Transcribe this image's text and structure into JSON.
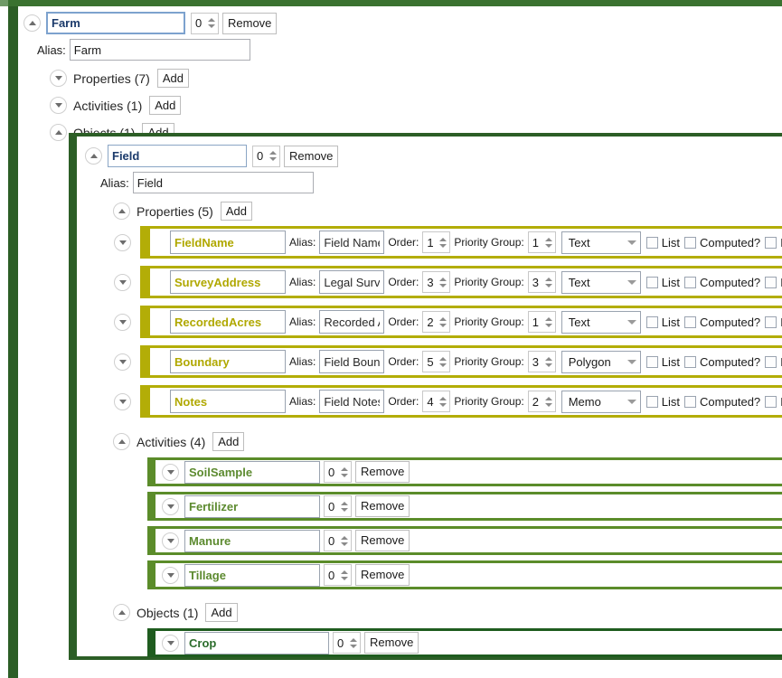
{
  "colors": {
    "panel_border_dark_green": "#2c5e26",
    "top_band_green": "#3a7230",
    "property_border_olive": "#b3ad07",
    "activity_border_green": "#5b8c2a",
    "object_border_green": "#1f5c1f",
    "property_name_text": "#b0a800",
    "activity_name_text": "#5c8a2f",
    "object_name_text": "#2c6d2c",
    "root_name_text": "#1b3a6b"
  },
  "labels": {
    "alias": "Alias:",
    "order": "Order:",
    "priority_group": "Priority Group:",
    "add": "Add",
    "remove": "Remove",
    "list": "List",
    "computed": "Computed?",
    "is_truncated": "Is"
  },
  "root_object": {
    "name": "Farm",
    "count": "0",
    "remove_label": "Remove",
    "alias_label": "Alias:",
    "alias_value": "Farm",
    "sections": [
      {
        "key": "properties",
        "label": "Properties (7)",
        "expanded": false,
        "add_label": "Add"
      },
      {
        "key": "activities",
        "label": "Activities (1)",
        "expanded": false,
        "add_label": "Add"
      },
      {
        "key": "objects",
        "label": "Objects (1)",
        "expanded": true,
        "add_label": "Add"
      }
    ]
  },
  "nested_object": {
    "name": "Field",
    "count": "0",
    "remove_label": "Remove",
    "alias_label": "Alias:",
    "alias_value": "Field",
    "properties_section": {
      "label": "Properties (5)",
      "expanded": true,
      "add_label": "Add"
    },
    "properties": [
      {
        "name": "FieldName",
        "alias": "Field Name",
        "order": "1",
        "priority_group": "1",
        "type": "Text",
        "list": false,
        "computed": false,
        "is_flag": false
      },
      {
        "name": "SurveyAddress",
        "alias": "Legal Survey",
        "order": "3",
        "priority_group": "3",
        "type": "Text",
        "list": false,
        "computed": false,
        "is_flag": false
      },
      {
        "name": "RecordedAcres",
        "alias": "Recorded Ac",
        "order": "2",
        "priority_group": "1",
        "type": "Text",
        "list": false,
        "computed": false,
        "is_flag": false
      },
      {
        "name": "Boundary",
        "alias": "Field Bounda",
        "order": "5",
        "priority_group": "3",
        "type": "Polygon",
        "list": false,
        "computed": false,
        "is_flag": false
      },
      {
        "name": "Notes",
        "alias": "Field Notes",
        "order": "4",
        "priority_group": "2",
        "type": "Memo",
        "list": false,
        "computed": false,
        "is_flag": false
      }
    ],
    "activities_section": {
      "label": "Activities (4)",
      "expanded": true,
      "add_label": "Add"
    },
    "activities": [
      {
        "name": "SoilSample",
        "count": "0",
        "remove_label": "Remove"
      },
      {
        "name": "Fertilizer",
        "count": "0",
        "remove_label": "Remove"
      },
      {
        "name": "Manure",
        "count": "0",
        "remove_label": "Remove"
      },
      {
        "name": "Tillage",
        "count": "0",
        "remove_label": "Remove"
      }
    ],
    "objects_section": {
      "label": "Objects (1)",
      "expanded": true,
      "add_label": "Add"
    },
    "child_objects": [
      {
        "name": "Crop",
        "count": "0",
        "remove_label": "Remove"
      }
    ]
  }
}
